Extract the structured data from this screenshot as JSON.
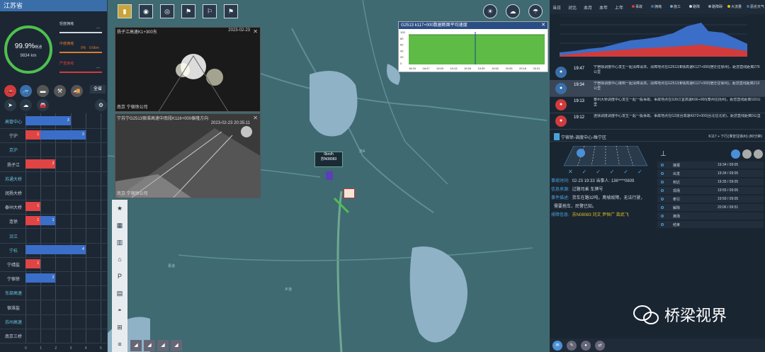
{
  "left": {
    "title": "江苏省",
    "gauge": {
      "pct": "99.9%",
      "pct_label": "畅通",
      "km": "9834 km"
    },
    "legend": [
      {
        "label": "轻度拥堵",
        "value": "—",
        "value2": "",
        "color": "#cfd8e3"
      },
      {
        "label": "中度拥堵",
        "value": "0%",
        "value2": "0.6km",
        "color": "#e07a2e"
      },
      {
        "label": "严重拥堵",
        "value": "—",
        "value2": "",
        "color": "#d23b3b"
      }
    ],
    "all_button": "全省",
    "icons": [
      {
        "name": "accident-icon",
        "glyph": "🚗",
        "color": "#d23b3b"
      },
      {
        "name": "car-icon",
        "glyph": "🚙",
        "color": "#3a6ea8"
      },
      {
        "name": "roadblock-icon",
        "glyph": "▬",
        "color": "#555"
      },
      {
        "name": "construction-icon",
        "glyph": "⚒",
        "color": "#555"
      },
      {
        "name": "truck-icon",
        "glyph": "🚚",
        "color": "#555"
      },
      {
        "name": "navigation-icon",
        "glyph": "➤",
        "color": "#2b3947"
      },
      {
        "name": "weather-icon",
        "glyph": "☁",
        "color": "#2b3947"
      },
      {
        "name": "traffic-icon",
        "glyph": "🚘",
        "color": "#2b3947"
      },
      {
        "name": "settings-icon",
        "glyph": "⚙",
        "color": "#2b3947"
      }
    ],
    "bar_chart": {
      "categories": [
        {
          "name": "高管中心",
          "cyan": true,
          "red": 0,
          "blue": 3
        },
        {
          "name": "宁沪",
          "cyan": false,
          "red": 1,
          "blue": 3
        },
        {
          "name": "京沪",
          "cyan": true,
          "red": 0,
          "blue": 0
        },
        {
          "name": "扬子江",
          "cyan": false,
          "red": 2,
          "blue": 0
        },
        {
          "name": "苏通大桥",
          "cyan": true,
          "red": 0,
          "blue": 0
        },
        {
          "name": "润扬大桥",
          "cyan": false,
          "red": 0,
          "blue": 0
        },
        {
          "name": "泰州大桥",
          "cyan": false,
          "red": 1,
          "blue": 0
        },
        {
          "name": "连徐",
          "cyan": false,
          "red": 1,
          "blue": 1
        },
        {
          "name": "沿江",
          "cyan": true,
          "red": 0,
          "blue": 0
        },
        {
          "name": "宁杭",
          "cyan": true,
          "red": 0,
          "blue": 4
        },
        {
          "name": "宁靖盐",
          "cyan": false,
          "red": 1,
          "blue": 0
        },
        {
          "name": "宁宿徐",
          "cyan": false,
          "red": 0,
          "blue": 2
        },
        {
          "name": "东部高速",
          "cyan": true,
          "red": 0,
          "blue": 0
        },
        {
          "name": "宿淮盐",
          "cyan": false,
          "red": 0,
          "blue": 0
        },
        {
          "name": "苏州高速",
          "cyan": true,
          "red": 0,
          "blue": 0
        },
        {
          "name": "南京三桥",
          "cyan": false,
          "red": 0,
          "blue": 0
        }
      ],
      "xticks": [
        "0",
        "1",
        "2",
        "3",
        "4",
        "5"
      ]
    }
  },
  "map": {
    "toolbar": [
      {
        "name": "traffic-light-icon",
        "glyph": "▮",
        "yellow": true
      },
      {
        "name": "camera-icon",
        "glyph": "◉"
      },
      {
        "name": "camera-ball-icon",
        "glyph": "◎"
      },
      {
        "name": "flag-icon",
        "glyph": "⚑"
      },
      {
        "name": "flag-check-icon",
        "glyph": "⚐"
      },
      {
        "name": "flag-x-icon",
        "glyph": "⚑"
      }
    ],
    "weather_buttons": [
      {
        "name": "sunny-cloud-icon",
        "glyph": "☀"
      },
      {
        "name": "cloud-icon",
        "glyph": "☁"
      },
      {
        "name": "storm-icon",
        "glyph": "☂"
      }
    ],
    "cameras": [
      {
        "header": "扬子江高速K1+300东",
        "ts": "2023-02-23",
        "loc": "南京  宁宿徐公司"
      },
      {
        "header": "宁苏宁G2513宿淮高速中南段K116+000泰隆方向",
        "ts": "2023-02-23 20:35:11",
        "loc": "南京  宁宿徐公司"
      }
    ],
    "speed_chart": {
      "title": "G2513 k117+000数据断面平均速度",
      "yticks": [
        "100",
        "80",
        "60",
        "40",
        "20",
        "0"
      ],
      "xticks": [
        "18:34",
        "18:47",
        "19:00",
        "19:13",
        "19:26",
        "19:39",
        "19:52",
        "20:05",
        "20:18",
        "20:31"
      ]
    },
    "vehicle": {
      "speed": "0km/h",
      "plate": "苏N08083"
    },
    "side_icons": [
      {
        "name": "star-icon",
        "glyph": "★"
      },
      {
        "name": "building-icon",
        "glyph": "▦"
      },
      {
        "name": "chart-icon",
        "glyph": "▥"
      },
      {
        "name": "home-icon",
        "glyph": "⌂"
      },
      {
        "name": "parking-icon",
        "glyph": "P"
      },
      {
        "name": "toll-icon",
        "glyph": "▤"
      },
      {
        "name": "tunnel-icon",
        "glyph": "◓"
      },
      {
        "name": "grid-icon",
        "glyph": "⊞"
      },
      {
        "name": "menu-icon",
        "glyph": "≡"
      }
    ],
    "labels": [
      "县道",
      "苏A",
      "乡道"
    ]
  },
  "right": {
    "tabs": [
      "当日",
      "对比",
      "本月",
      "本年",
      "上年"
    ],
    "legend": [
      {
        "label": "事故",
        "color": "#d23b3b"
      },
      {
        "label": "拥堵",
        "color": "#3a6ea8"
      },
      {
        "label": "施工",
        "color": "#6ba3c8"
      },
      {
        "label": "路障",
        "color": "#cfd8e3"
      },
      {
        "label": "路障碍",
        "color": "#999"
      },
      {
        "label": "大流量",
        "color": "#e0c020"
      },
      {
        "label": "恶劣天气",
        "color": "#3a6ea8"
      }
    ],
    "events": [
      {
        "time": "19:47",
        "desc": "宁宿徐调度中心发生一起清障请求。清障地点在G2513淮徐高速K127+000(宿迁往徐州)，距您直线距离276公里",
        "color": "#3a6ea8",
        "sel": false
      },
      {
        "time": "19:34",
        "desc": "宁宿徐调度中心接到一起清障请求。清障地点在G2513淮徐高速K117+000(宿迁往徐州)，距您直线距离213公里",
        "color": "#3a6ea8",
        "sel": true
      },
      {
        "time": "19:13",
        "desc": "泰州大桥调度中心发生一起一般事故。事故地点在S39江宜高速K66+000(泰州往扬州)，距您直线距离102公里",
        "color": "#d23b3b",
        "sel": false
      },
      {
        "time": "19:12",
        "desc": "连徐调度调度中心发生一起一般事故。事故地点在G3京台高速K672+000(台北往北京)，距您直线距离0公里",
        "color": "#d23b3b",
        "sel": false
      }
    ],
    "detail_header": {
      "center": "宁宿徐-调度中心-睢宁区",
      "route": "K117 + 下行(淮安往徐州) (80分钟)"
    },
    "detail": [
      {
        "k": "事故时间:",
        "v": "02-23 19:33    当事人:    136****0609"
      },
      {
        "k": "信息来源:",
        "v": "过路司乘            车牌号"
      },
      {
        "k": "事件描述:",
        "v": "货车在路32吨，爬坡故障，无法行驶，"
      },
      {
        "k": "",
        "v": "需要拖车，民警已知。"
      },
      {
        "k": "排障信息:",
        "v": "苏N08083  刘文  尹恒广  苗武飞"
      }
    ],
    "flow": [
      {
        "name": "接报",
        "time": "19:34 / 09:05"
      },
      {
        "name": "出发",
        "time": "19:34 / 09:05"
      },
      {
        "name": "到达",
        "time": "19:35 / 09:05"
      },
      {
        "name": "现场",
        "time": "19:55 / 09:05"
      },
      {
        "name": "牵引",
        "time": "19:59 / 09:05"
      },
      {
        "name": "解除",
        "time": "20:06 / 09:51"
      },
      {
        "name": "离场",
        "time": ""
      },
      {
        "name": "结束",
        "time": ""
      }
    ]
  },
  "watermark": "桥梁视界"
}
